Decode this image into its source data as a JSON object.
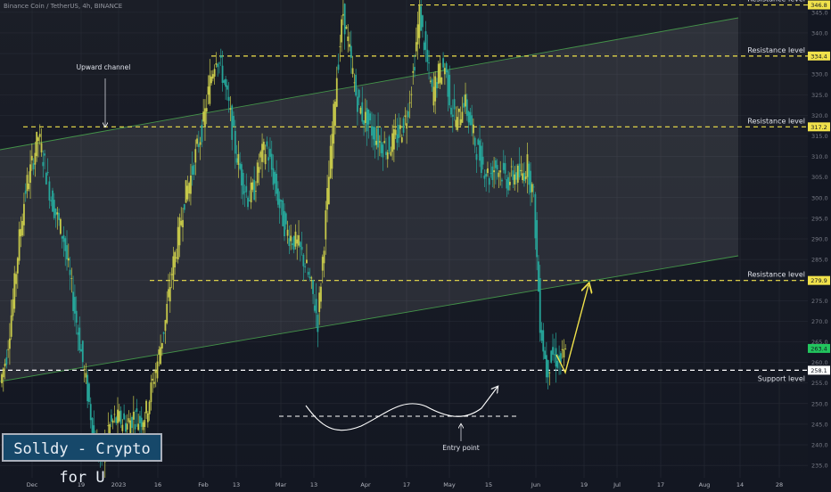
{
  "header": {
    "symbol": "Binance Coin / TetherUS, 4h, BINANCE",
    "currency": "USDT"
  },
  "branding": {
    "label": "Solldy - Crypto for U"
  },
  "colors": {
    "background": "#131722",
    "candle_up": "#c7c94a",
    "candle_down": "#26a69a",
    "level_yellow": "#f1e24b",
    "support_white": "#ffffff",
    "channel_line": "#4caf50",
    "current_price": "#22c55e"
  },
  "chart_data": {
    "type": "line",
    "y_axis": {
      "range": [
        232,
        348
      ],
      "ticks": [
        235,
        240,
        245,
        250,
        255,
        260,
        265,
        270,
        275,
        280,
        285,
        290,
        295,
        300,
        305,
        310,
        315,
        320,
        325,
        330,
        335,
        340,
        345
      ]
    },
    "x_axis": {
      "ticks": [
        "Dec",
        "19",
        "2023",
        "16",
        "Feb",
        "13",
        "Mar",
        "13",
        "Apr",
        "17",
        "May",
        "15",
        "Jun",
        "19",
        "Jul",
        "17",
        "Aug",
        "14",
        "28"
      ]
    },
    "series": [
      {
        "values": [
          255,
          262,
          275,
          290,
          302,
          308,
          315,
          308,
          300,
          295,
          290,
          280,
          270,
          260,
          250,
          240,
          236,
          244,
          246,
          246,
          245,
          247,
          246,
          248,
          255,
          262,
          270,
          282,
          290,
          300,
          305,
          312,
          318,
          328,
          335,
          330,
          322,
          312,
          305,
          300,
          302,
          310,
          312,
          305,
          298,
          292,
          290,
          288,
          284,
          278,
          270,
          290,
          310,
          330,
          345,
          335,
          325,
          320,
          318,
          315,
          313,
          312,
          314,
          316,
          320,
          330,
          345,
          335,
          325,
          330,
          332,
          322,
          318,
          324,
          318,
          312,
          308,
          305,
          308,
          306,
          304,
          306,
          305,
          308,
          300,
          270,
          258,
          262,
          260,
          262
        ]
      }
    ],
    "price_labels": [
      {
        "value": 346.8,
        "text": "346.8",
        "style": "yellow"
      },
      {
        "value": 334.4,
        "text": "334.4",
        "style": "yellow"
      },
      {
        "value": 317.2,
        "text": "317.2",
        "style": "yellow"
      },
      {
        "value": 279.9,
        "text": "279.9",
        "style": "yellow"
      },
      {
        "value": 263.4,
        "text": "263.4",
        "style": "green"
      },
      {
        "value": 258.1,
        "text": "258.1",
        "style": "white"
      }
    ],
    "levels": [
      {
        "value": 346.8,
        "label": "Resistance level",
        "color": "#f1e24b"
      },
      {
        "value": 334.4,
        "label": "Resistance level",
        "color": "#f1e24b"
      },
      {
        "value": 317.2,
        "label": "Resistance level",
        "color": "#f1e24b"
      },
      {
        "value": 279.9,
        "label": "Resistance level",
        "color": "#f1e24b"
      },
      {
        "value": 258.1,
        "label": "Support level",
        "color": "#ffffff"
      }
    ],
    "annotations": [
      {
        "text": "Upward channel"
      },
      {
        "text": "Entry point"
      }
    ]
  }
}
